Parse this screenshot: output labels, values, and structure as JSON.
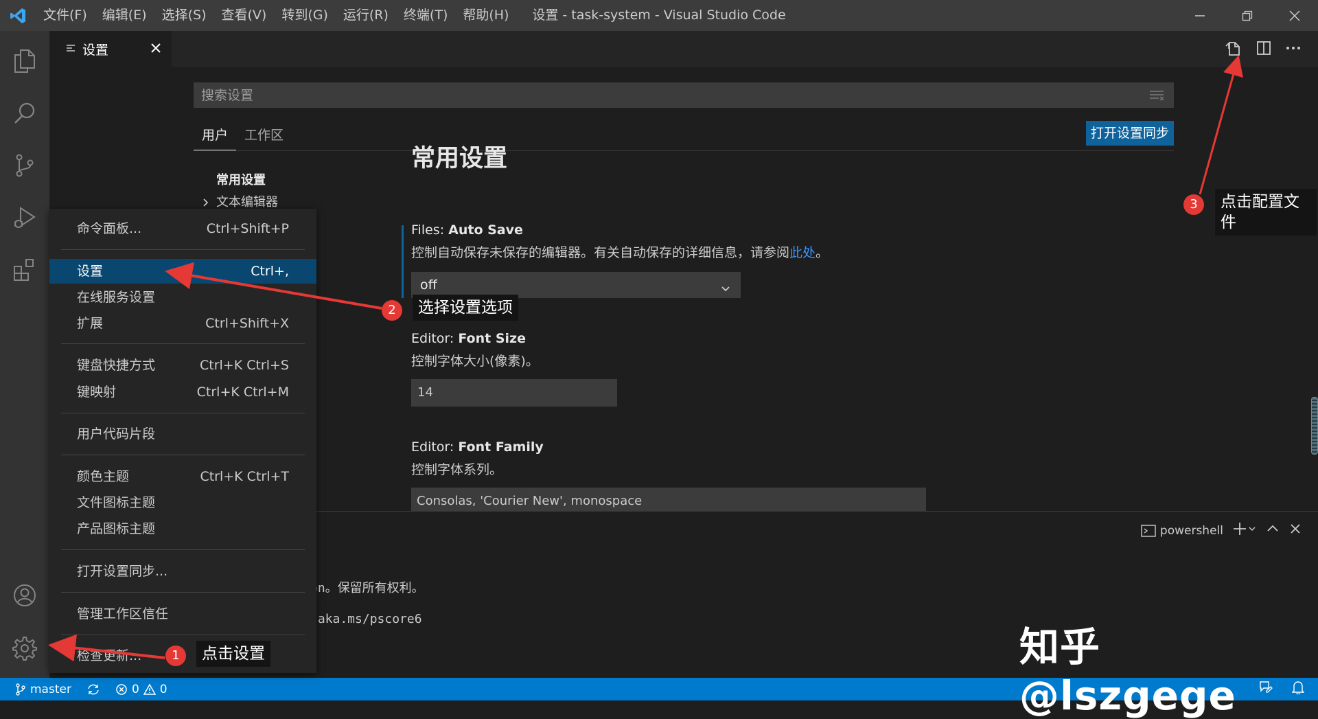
{
  "titlebar": {
    "menus": [
      "文件(F)",
      "编辑(E)",
      "选择(S)",
      "查看(V)",
      "转到(G)",
      "运行(R)",
      "终端(T)",
      "帮助(H)"
    ],
    "title": "设置 - task-system - Visual Studio Code"
  },
  "editor_tab": {
    "label": "设置"
  },
  "settings": {
    "search_placeholder": "搜索设置",
    "scope_tabs": [
      "用户",
      "工作区"
    ],
    "sync_button": "打开设置同步",
    "toc": {
      "header": "常用设置",
      "item": "文本编辑器"
    },
    "section_title": "常用设置",
    "auto_save": {
      "category": "Files: ",
      "name": "Auto Save",
      "desc": "控制自动保存未保存的编辑器。有关自动保存的详细信息，请参阅",
      "link": "此处",
      "desc_end": "。",
      "value": "off"
    },
    "font_size": {
      "category": "Editor: ",
      "name": "Font Size",
      "desc": "控制字体大小(像素)。",
      "value": "14"
    },
    "font_family": {
      "category": "Editor: ",
      "name": "Font Family",
      "desc": "控制字体系列。",
      "value": "Consolas, 'Courier New', monospace"
    }
  },
  "panel": {
    "shell": "powershell",
    "line1": "on。保留所有权利。",
    "line2": "/aka.ms/pscore6"
  },
  "context_menu": {
    "items": [
      {
        "label": "命令面板...",
        "key": "Ctrl+Shift+P"
      },
      {
        "label": "设置",
        "key": "Ctrl+,"
      },
      {
        "label": "在线服务设置",
        "key": ""
      },
      {
        "label": "扩展",
        "key": "Ctrl+Shift+X"
      },
      {
        "label": "键盘快捷方式",
        "key": "Ctrl+K Ctrl+S"
      },
      {
        "label": "键映射",
        "key": "Ctrl+K Ctrl+M"
      },
      {
        "label": "用户代码片段",
        "key": ""
      },
      {
        "label": "颜色主题",
        "key": "Ctrl+K Ctrl+T"
      },
      {
        "label": "文件图标主题",
        "key": ""
      },
      {
        "label": "产品图标主题",
        "key": ""
      },
      {
        "label": "打开设置同步...",
        "key": ""
      },
      {
        "label": "管理工作区信任",
        "key": ""
      },
      {
        "label": "检查更新...",
        "key": ""
      }
    ]
  },
  "statusbar": {
    "branch": "master",
    "errors": "0",
    "warnings": "0"
  },
  "annotations": {
    "step1": {
      "num": "1",
      "text": "点击设置"
    },
    "step2": {
      "num": "2",
      "text": "选择设置选项"
    },
    "step3": {
      "num": "3",
      "text": "点击配置文件"
    }
  },
  "watermark": "知乎 @lszgege",
  "colors": {
    "accent": "#007acc",
    "menu_selection": "#094771",
    "sync_button": "#0e639c",
    "annotation_red": "#e53935",
    "link": "#3794ff"
  }
}
